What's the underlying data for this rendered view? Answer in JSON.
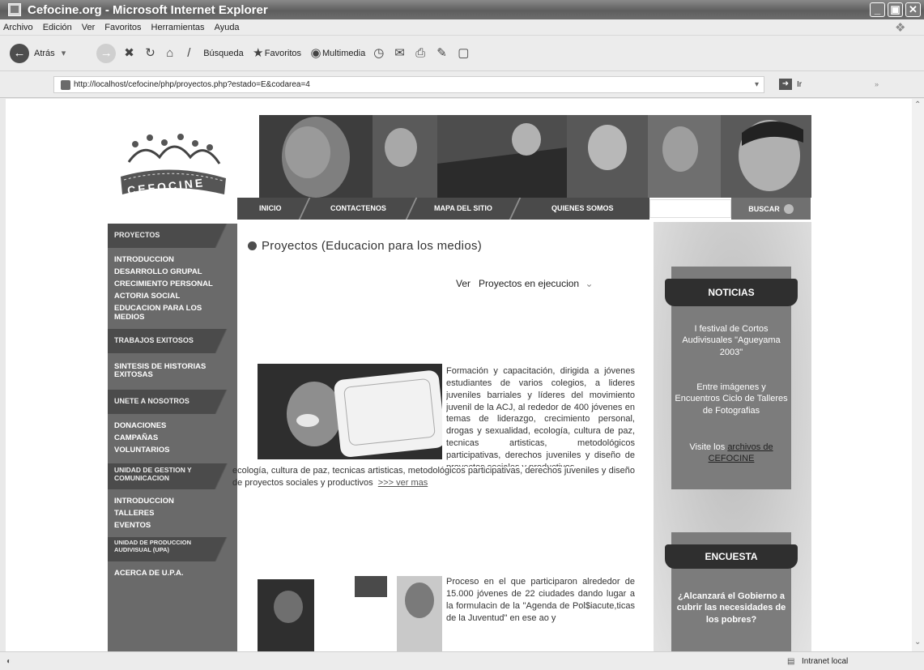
{
  "window": {
    "title": "Cefocine.org - Microsoft Internet Explorer"
  },
  "menu": [
    "Archivo",
    "Edición",
    "Ver",
    "Favoritos",
    "Herramientas",
    "Ayuda"
  ],
  "toolbar": {
    "back": "Atrás",
    "search": "Búsqueda",
    "favorites": "Favoritos",
    "multimedia": "Multimedia"
  },
  "address": {
    "url": "http://localhost/cefocine/php/proyectos.php?estado=E&codarea=4",
    "go": "Ir"
  },
  "status": {
    "zone": "Intranet local"
  },
  "site": {
    "logo_text": "CEFOCINE",
    "nav": [
      "INICIO",
      "CONTACTENOS",
      "MAPA DEL SITIO",
      "QUIENES SOMOS"
    ],
    "search_button": "BUSCAR"
  },
  "sidebar": {
    "sections": [
      {
        "head": "PROYECTOS",
        "items": [
          "INTRODUCCION",
          "DESARROLLO GRUPAL",
          "CRECIMIENTO PERSONAL",
          "ACTORIA SOCIAL",
          "EDUCACION PARA LOS MEDIOS"
        ]
      },
      {
        "head": "TRABAJOS EXITOSOS",
        "items": [
          "SINTESIS DE HISTORIAS EXITOSAS"
        ]
      },
      {
        "head": "UNETE A NOSOTROS",
        "items": [
          "DONACIONES",
          "CAMPAÑAS",
          "VOLUNTARIOS"
        ]
      },
      {
        "head": "UNIDAD DE GESTION Y COMUNICACION",
        "items": [
          "INTRODUCCION",
          "TALLERES",
          "EVENTOS"
        ]
      },
      {
        "head": "UNIDAD DE PRODUCCION AUDIVISUAL (UPA)",
        "items": [
          "ACERCA DE U.P.A."
        ]
      }
    ]
  },
  "content": {
    "title": "Proyectos (Educacion para los medios)",
    "filter_label": "Ver",
    "filter_value": "Proyectos en ejecucion",
    "project1": {
      "text": "Formación y capacitación, dirigida a jóvenes estudiantes de varios colegios, a lideres juveniles barriales y líderes del movimiento juvenil de la ACJ, al rededor de 400 jóvenes en temas de liderazgo, crecimiento personal, drogas y sexualidad, ecología, cultura de paz, tecnicas artisticas, metodológicos participativas, derechos juveniles y diseño de proyectos sociales y productivos",
      "more": ">>> ver mas"
    },
    "project2": {
      "text": "Proceso en el que participaron alrededor de 15.000 jóvenes de 22 ciudades dando lugar a la formulacin de la \"Agenda de Pol$iacute,ticas de la Juventud\" en ese ao y"
    }
  },
  "news": {
    "head": "NOTICIAS",
    "item1": "I festival de Cortos Audivisuales \"Agueyama 2003\"",
    "item2": "Entre imágenes y Encuentros Ciclo de Talleres de Fotografias",
    "visit_prefix": "Visite los",
    "visit_link": "archivos de CEFOCINE"
  },
  "poll": {
    "head": "ENCUESTA",
    "question": "¿Alcanzará el Gobierno a cubrir las necesidades de los pobres?"
  }
}
